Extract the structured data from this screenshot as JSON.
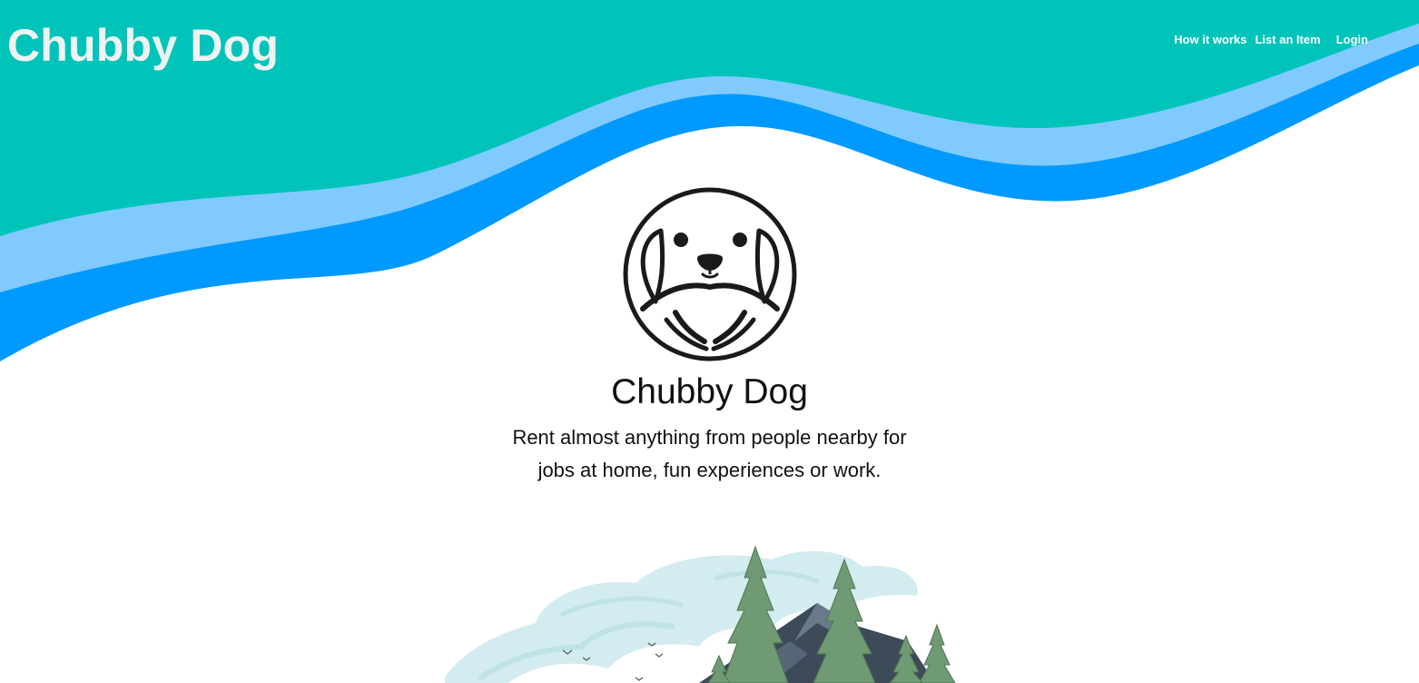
{
  "header": {
    "site_name": "Chubby Dog",
    "nav": {
      "how_it_works": "How it works",
      "list_item": "List an Item",
      "login": "Login"
    }
  },
  "hero": {
    "title": "Chubby Dog",
    "tagline": "Rent almost anything from people nearby for jobs at home, fun experiences or work."
  },
  "colors": {
    "header_teal": "#00c4ba",
    "wave_light_blue": "#80caff",
    "wave_blue": "#0099ff",
    "background": "#ffffff",
    "text": "#111111"
  },
  "icons": {
    "logo": "chubby-dog-logo-icon",
    "illustration": "forest-mountain-illustration"
  }
}
